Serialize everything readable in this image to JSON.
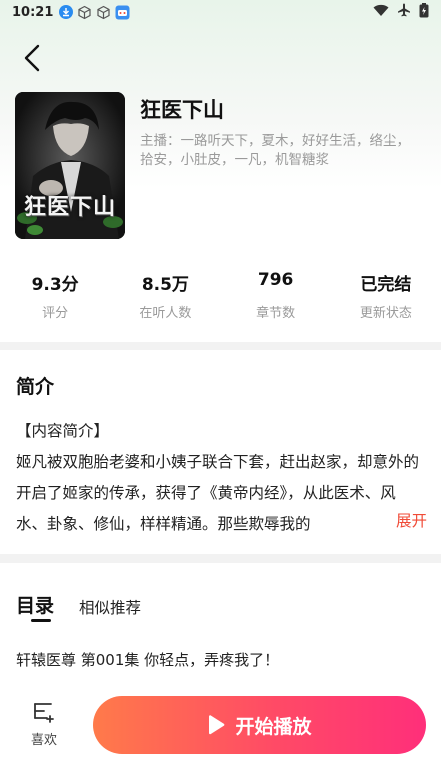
{
  "status_bar": {
    "time": "10:21",
    "icons_left": [
      "download-icon",
      "cube-icon",
      "cube-icon",
      "app-icon"
    ],
    "icons_right": [
      "wifi-icon",
      "airplane-icon",
      "battery-icon"
    ]
  },
  "book": {
    "cover_title": "狂医下山",
    "title": "狂医下山",
    "hosts": "主播：一路听天下，夏木，好好生活，络尘，拾安，小肚皮，一凡，机智糖浆"
  },
  "stats": [
    {
      "value": "9.3分",
      "label": "评分"
    },
    {
      "value": "8.5万",
      "label": "在听人数"
    },
    {
      "value": "796",
      "label": "章节数"
    },
    {
      "value": "已完结",
      "label": "更新状态"
    }
  ],
  "intro": {
    "heading": "简介",
    "para1": "【内容简介】",
    "para2": "姬凡被双胞胎老婆和小姨子联合下套，赶出赵家，却意外的开启了姬家的传承，获得了《黄帝内经》，从此医术、风水、卦象、修仙，样样精通。那些欺辱我的",
    "expand": "展开"
  },
  "catalog": {
    "tab_catalog": "目录",
    "tab_similar": "相似推荐",
    "episode": "轩辕医尊 第001集 你轻点，弄疼我了！"
  },
  "bottom": {
    "like_label": "喜欢",
    "play_label": "开始播放"
  },
  "colors": {
    "accent_red": "#f04a36",
    "play_gradient_start": "#ff7a4a",
    "play_gradient_end": "#ff2f7a"
  }
}
